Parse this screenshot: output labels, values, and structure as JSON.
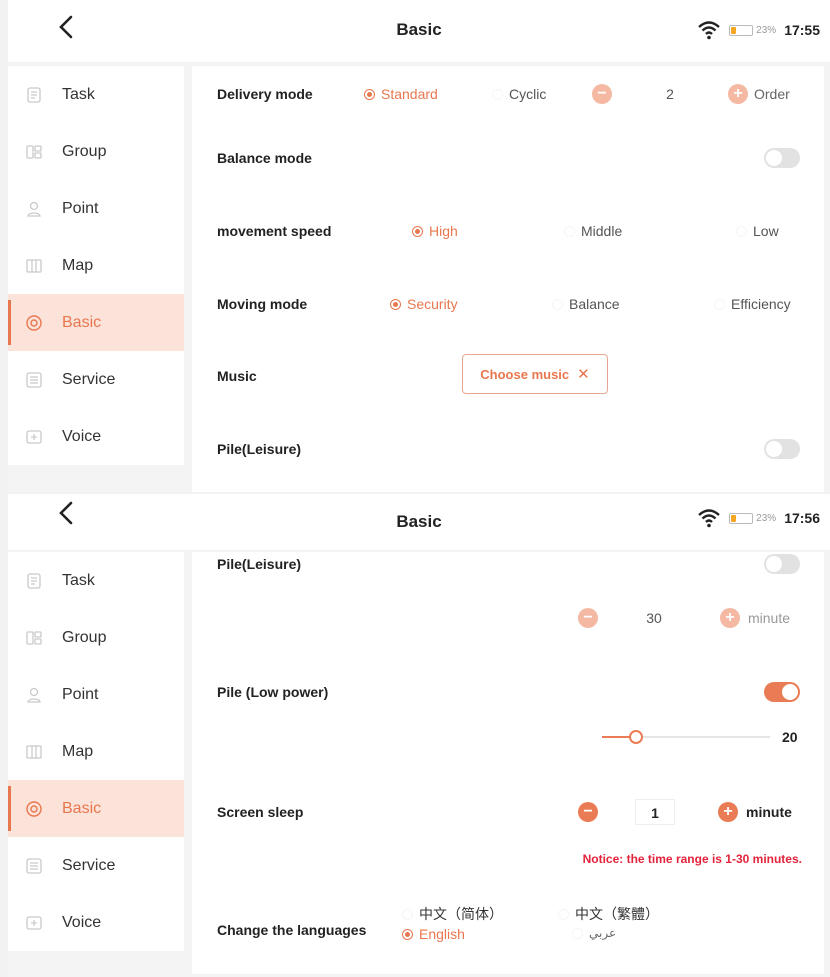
{
  "status": {
    "battery": "23%",
    "time1": "17:55",
    "time2": "17:56"
  },
  "header": {
    "title": "Basic"
  },
  "sidebar": {
    "items": [
      {
        "label": "Task",
        "icon": "task-icon"
      },
      {
        "label": "Group",
        "icon": "group-icon"
      },
      {
        "label": "Point",
        "icon": "point-icon"
      },
      {
        "label": "Map",
        "icon": "map-icon"
      },
      {
        "label": "Basic",
        "icon": "settings-icon",
        "active": true
      },
      {
        "label": "Service",
        "icon": "service-icon"
      },
      {
        "label": "Voice",
        "icon": "voice-icon"
      }
    ]
  },
  "delivery_mode": {
    "label": "Delivery mode",
    "standard": "Standard",
    "cyclic": "Cyclic",
    "count": "2",
    "order": "Order"
  },
  "balance_mode": {
    "label": "Balance mode",
    "enabled": false
  },
  "movement_speed": {
    "label": "movement speed",
    "high": "High",
    "middle": "Middle",
    "low": "Low"
  },
  "moving_mode": {
    "label": "Moving mode",
    "security": "Security",
    "balance": "Balance",
    "efficiency": "Efficiency"
  },
  "music": {
    "label": "Music",
    "button": "Choose music",
    "clear": "✕"
  },
  "pile_leisure": {
    "label": "Pile(Leisure)",
    "value": "30",
    "unit": "minute",
    "enabled": false
  },
  "pile_low_power": {
    "label": "Pile (Low power)",
    "enabled": true,
    "level": 20,
    "level_label": "20"
  },
  "screen_sleep": {
    "label": "Screen sleep",
    "value": "1",
    "unit": "minute",
    "notice": "Notice: the time range is 1-30 minutes."
  },
  "languages": {
    "label": "Change the languages",
    "simplified": "中文（简体）",
    "traditional": "中文（繁體）",
    "english": "English",
    "arabic": "عربي"
  },
  "colors": {
    "accent": "#e8774f",
    "notice": "#e2233a"
  }
}
